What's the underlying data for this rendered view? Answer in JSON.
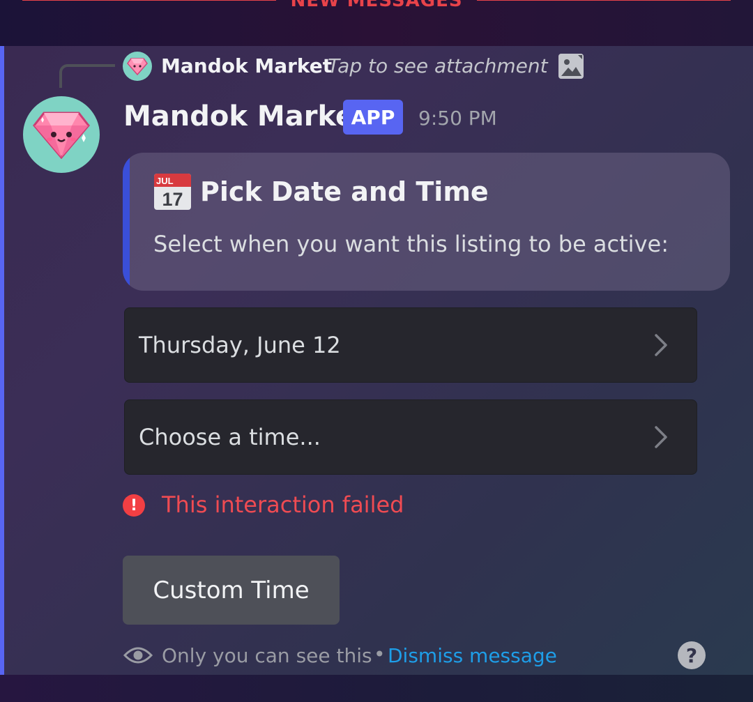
{
  "new_messages_bar": {
    "label": "NEW MESSAGES"
  },
  "reply": {
    "author": "Mandok Market",
    "text": "Tap to see attachment",
    "icon": "image-icon"
  },
  "message": {
    "author": "Mandok Market",
    "badge": "APP",
    "timestamp": "9:50 PM",
    "avatar_icon": "pink-diamond-avatar"
  },
  "embed": {
    "icon": "calendar-icon",
    "icon_month": "JUL",
    "icon_day": "17",
    "title": "Pick Date and Time",
    "description": "Select when you want this listing to be active:",
    "accent_color": "#3a4fd8"
  },
  "selects": {
    "date": {
      "value": "Thursday, June 12"
    },
    "time": {
      "placeholder": "Choose a time..."
    }
  },
  "error": {
    "text": "This interaction failed",
    "color": "#f04b52"
  },
  "custom_time_button": {
    "label": "Custom Time"
  },
  "footer": {
    "visibility_text": "Only you can see this",
    "separator": "•",
    "dismiss_link": "Dismiss message",
    "help_symbol": "?"
  },
  "colors": {
    "blurple": "#5865f2",
    "link": "#1e9ee8",
    "danger": "#f23f43"
  }
}
